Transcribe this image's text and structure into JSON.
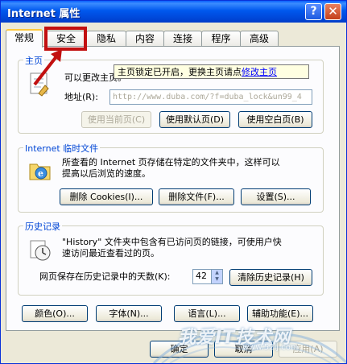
{
  "window": {
    "title": "Internet 属性"
  },
  "tabs": [
    {
      "label": "常规"
    },
    {
      "label": "安全"
    },
    {
      "label": "隐私"
    },
    {
      "label": "内容"
    },
    {
      "label": "连接"
    },
    {
      "label": "程序"
    },
    {
      "label": "高级"
    }
  ],
  "home": {
    "title": "主页",
    "description": "可以更改主页。",
    "address_label": "地址(R):",
    "address_value": "http://www.duba.com/?f=duba_lock&un99_4",
    "btn_current": "使用当前页(C)",
    "btn_default": "使用默认页(D)",
    "btn_blank": "使用空白页(B)"
  },
  "tooltip": {
    "text": "主页锁定已开启，更换主页请点",
    "link": "修改主页"
  },
  "temp": {
    "title": "Internet 临时文件",
    "description_line1": "所查看的 Internet 页存储在特定的文件夹中，这样可以",
    "description_line2": "提高以后浏览的速度。",
    "btn_cookies": "删除 Cookies(I)...",
    "btn_files": "删除文件(F)...",
    "btn_settings": "设置(S)..."
  },
  "history": {
    "title": "历史记录",
    "description_line1": "\"History\" 文件夹中包含有已访问页的链接，可使用户快",
    "description_line2": "速访问最近查看过的页。",
    "days_label": "网页保存在历史记录中的天数(K):",
    "days_value": "42",
    "btn_clear": "清除历史记录(H)"
  },
  "bottom_buttons": {
    "colors": "颜色(O)...",
    "fonts": "字体(N)...",
    "languages": "语言(L)...",
    "accessibility": "辅助功能(E)..."
  },
  "dialog_buttons": {
    "ok": "确定",
    "cancel": "取消",
    "apply": "应用(A)"
  },
  "watermark": {
    "text": "我爱IT技术网",
    "sub": "www.52ij.com"
  },
  "colors": {
    "title_blue": "#0058ee",
    "group_title": "#0046d5",
    "highlight_red": "#c21010"
  }
}
